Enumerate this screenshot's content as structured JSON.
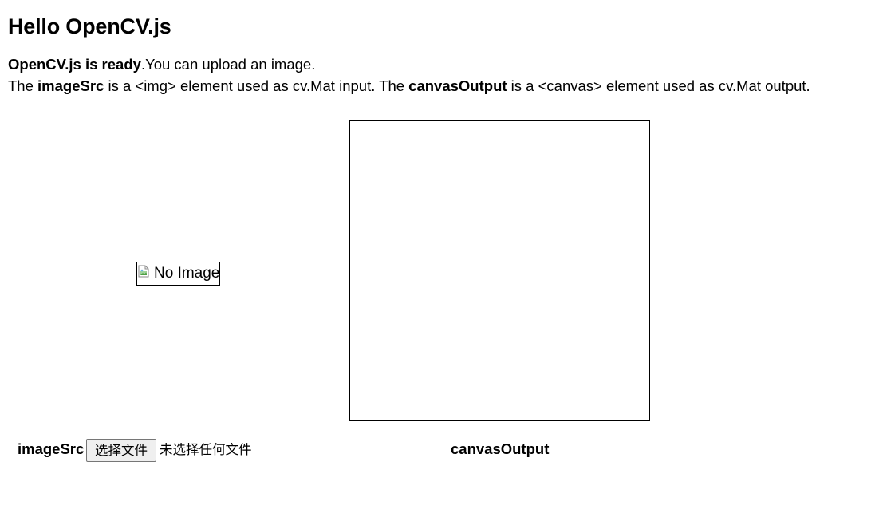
{
  "page": {
    "title": "Hello OpenCV.js"
  },
  "status": {
    "ready_bold": "OpenCV.js is ready",
    "ready_rest": ".You can upload an image."
  },
  "description": {
    "part1": "The ",
    "image_src_name": "imageSrc",
    "part2": " is a <img> element used as cv.Mat input. The ",
    "canvas_output_name": "canvasOutput",
    "part3": " is a <canvas> element used as cv.Mat output."
  },
  "image_source": {
    "alt_text": "No Image",
    "caption": "imageSrc",
    "icon": "broken-image-icon"
  },
  "file_input": {
    "button_label": "选择文件",
    "status_text": "未选择任何文件"
  },
  "canvas_output": {
    "caption": "canvasOutput"
  }
}
